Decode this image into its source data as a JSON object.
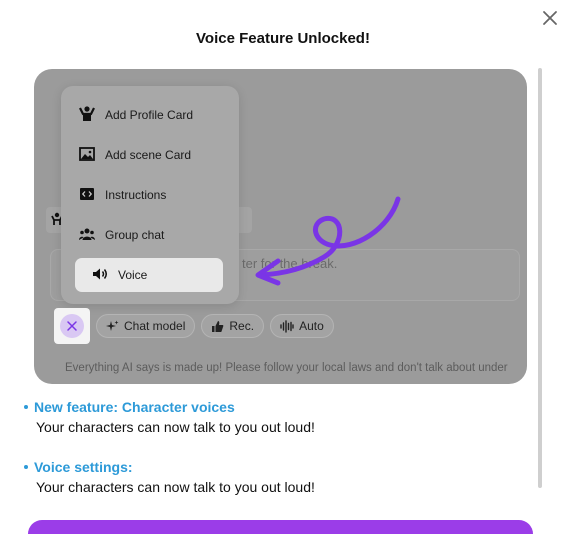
{
  "dialog": {
    "title": "Voice Feature Unlocked!"
  },
  "preview": {
    "menu_items": [
      {
        "label": "Add Profile Card",
        "icon": "person-raised-icon"
      },
      {
        "label": "Add scene Card",
        "icon": "image-icon"
      },
      {
        "label": "Instructions",
        "icon": "code-icon"
      },
      {
        "label": "Group chat",
        "icon": "group-icon"
      },
      {
        "label": "Voice",
        "icon": "speaker-icon"
      }
    ],
    "input_placeholder_fragment": "ter for the break.",
    "toolbar": {
      "chat_model": "Chat model",
      "rec": "Rec.",
      "auto": "Auto"
    },
    "disclaimer": "Everything AI says is made up! Please follow your local laws and don't talk about under",
    "accent_color": "#7a35e6"
  },
  "features": [
    {
      "title": "New feature: Character voices",
      "description": "Your characters can now talk to you out loud!"
    },
    {
      "title": "Voice settings:",
      "description": "Your characters can now talk to you out loud!"
    }
  ]
}
